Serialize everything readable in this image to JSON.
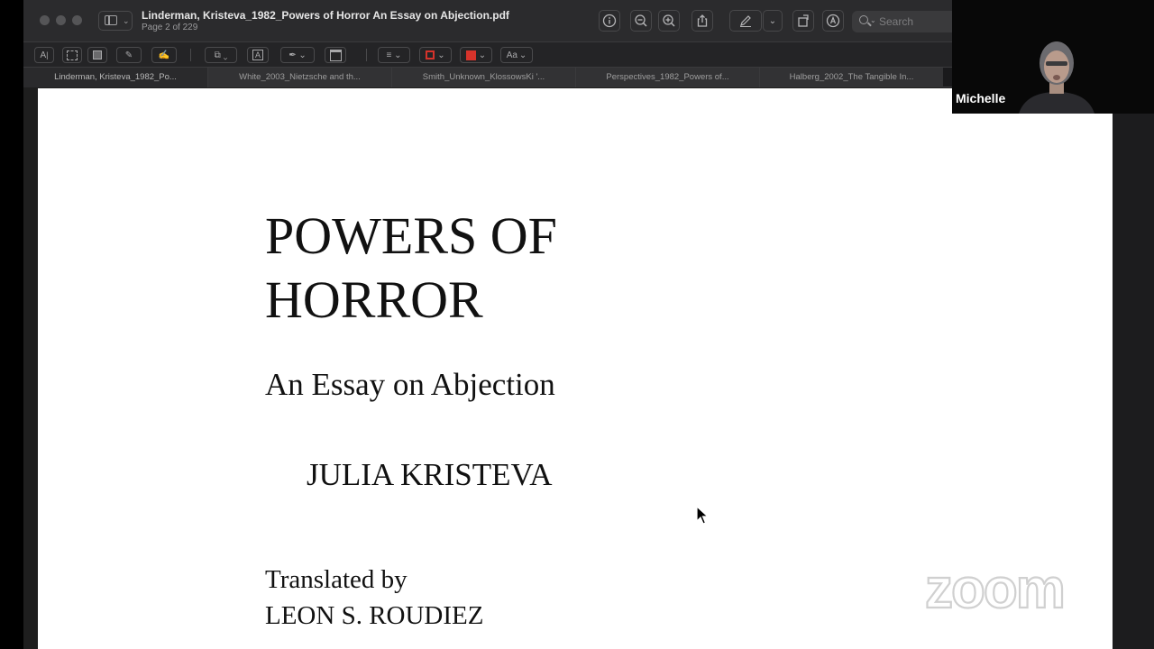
{
  "window": {
    "doc_title": "Linderman, Kristeva_1982_Powers of Horror An Essay on Abjection.pdf",
    "page_indicator": "Page 2 of 229",
    "search_placeholder": "Search"
  },
  "toolbar_icons": [
    "info-icon",
    "zoom-out-icon",
    "zoom-in-icon",
    "share-icon",
    "highlight-pen-icon",
    "chevron-down-icon",
    "rotate-icon",
    "markup-icon",
    "search-icon"
  ],
  "markup_tools": {
    "text_select": "A",
    "font_label": "Aa",
    "fill_color": "#d6332b",
    "border_color": "#d6332b"
  },
  "tabs": [
    {
      "label": "Linderman, Kristeva_1982_Po..."
    },
    {
      "label": "White_2003_Nietzsche and th..."
    },
    {
      "label": "Smith_Unknown_KlossowsKi '..."
    },
    {
      "label": "Perspectives_1982_Powers of..."
    },
    {
      "label": "Halberg_2002_The Tangible In..."
    }
  ],
  "pdf": {
    "title_line1": "POWERS OF",
    "title_line2": "HORROR",
    "subtitle": "An Essay on Abjection",
    "author": "JULIA KRISTEVA",
    "translated_by": "Translated by",
    "translator": "LEON S. ROUDIEZ"
  },
  "video": {
    "participant_name": "Michelle",
    "watermark": "zoom"
  }
}
